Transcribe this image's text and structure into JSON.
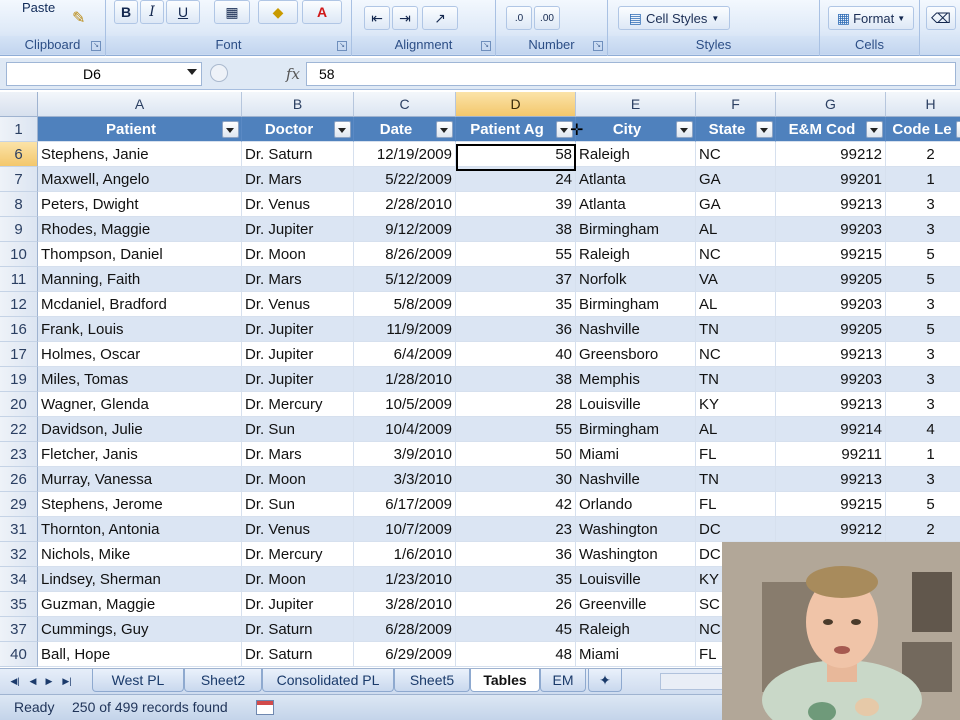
{
  "ribbon": {
    "groups": [
      {
        "label": "Clipboard"
      },
      {
        "label": "Font"
      },
      {
        "label": "Alignment"
      },
      {
        "label": "Number"
      },
      {
        "label": "Styles"
      },
      {
        "label": "Cells"
      }
    ],
    "paste_label": "Paste",
    "bold_label": "B",
    "italic_label": "I",
    "underline_label": "U",
    "font_color_glyph": "A",
    "cell_styles_label": "Cell Styles",
    "format_label": "Format"
  },
  "formula_bar": {
    "name_box": "D6",
    "fx_label": "fx",
    "value": "58"
  },
  "columns": [
    "A",
    "B",
    "C",
    "D",
    "E",
    "F",
    "G",
    "H"
  ],
  "selected_column": "D",
  "header_row": {
    "row_number": "1",
    "cells": [
      "Patient",
      "Doctor",
      "Date",
      "Patient Ag",
      "City",
      "State",
      "E&M Cod",
      "Code Le"
    ]
  },
  "rows": [
    {
      "n": "6",
      "patient": "Stephens, Janie",
      "doctor": "Dr. Saturn",
      "date": "12/19/2009",
      "age": "58",
      "city": "Raleigh",
      "state": "NC",
      "code": "99212",
      "level": "2"
    },
    {
      "n": "7",
      "patient": "Maxwell, Angelo",
      "doctor": "Dr. Mars",
      "date": "5/22/2009",
      "age": "24",
      "city": "Atlanta",
      "state": "GA",
      "code": "99201",
      "level": "1"
    },
    {
      "n": "8",
      "patient": "Peters, Dwight",
      "doctor": "Dr. Venus",
      "date": "2/28/2010",
      "age": "39",
      "city": "Atlanta",
      "state": "GA",
      "code": "99213",
      "level": "3"
    },
    {
      "n": "9",
      "patient": "Rhodes, Maggie",
      "doctor": "Dr. Jupiter",
      "date": "9/12/2009",
      "age": "38",
      "city": "Birmingham",
      "state": "AL",
      "code": "99203",
      "level": "3"
    },
    {
      "n": "10",
      "patient": "Thompson, Daniel",
      "doctor": "Dr. Moon",
      "date": "8/26/2009",
      "age": "55",
      "city": "Raleigh",
      "state": "NC",
      "code": "99215",
      "level": "5"
    },
    {
      "n": "11",
      "patient": "Manning, Faith",
      "doctor": "Dr. Mars",
      "date": "5/12/2009",
      "age": "37",
      "city": "Norfolk",
      "state": "VA",
      "code": "99205",
      "level": "5"
    },
    {
      "n": "12",
      "patient": "Mcdaniel, Bradford",
      "doctor": "Dr. Venus",
      "date": "5/8/2009",
      "age": "35",
      "city": "Birmingham",
      "state": "AL",
      "code": "99203",
      "level": "3"
    },
    {
      "n": "16",
      "patient": "Frank, Louis",
      "doctor": "Dr. Jupiter",
      "date": "11/9/2009",
      "age": "36",
      "city": "Nashville",
      "state": "TN",
      "code": "99205",
      "level": "5"
    },
    {
      "n": "17",
      "patient": "Holmes, Oscar",
      "doctor": "Dr. Jupiter",
      "date": "6/4/2009",
      "age": "40",
      "city": "Greensboro",
      "state": "NC",
      "code": "99213",
      "level": "3"
    },
    {
      "n": "19",
      "patient": "Miles, Tomas",
      "doctor": "Dr. Jupiter",
      "date": "1/28/2010",
      "age": "38",
      "city": "Memphis",
      "state": "TN",
      "code": "99203",
      "level": "3"
    },
    {
      "n": "20",
      "patient": "Wagner, Glenda",
      "doctor": "Dr. Mercury",
      "date": "10/5/2009",
      "age": "28",
      "city": "Louisville",
      "state": "KY",
      "code": "99213",
      "level": "3"
    },
    {
      "n": "22",
      "patient": "Davidson, Julie",
      "doctor": "Dr. Sun",
      "date": "10/4/2009",
      "age": "55",
      "city": "Birmingham",
      "state": "AL",
      "code": "99214",
      "level": "4"
    },
    {
      "n": "23",
      "patient": "Fletcher, Janis",
      "doctor": "Dr. Mars",
      "date": "3/9/2010",
      "age": "50",
      "city": "Miami",
      "state": "FL",
      "code": "99211",
      "level": "1"
    },
    {
      "n": "26",
      "patient": "Murray, Vanessa",
      "doctor": "Dr. Moon",
      "date": "3/3/2010",
      "age": "30",
      "city": "Nashville",
      "state": "TN",
      "code": "99213",
      "level": "3"
    },
    {
      "n": "29",
      "patient": "Stephens, Jerome",
      "doctor": "Dr. Sun",
      "date": "6/17/2009",
      "age": "42",
      "city": "Orlando",
      "state": "FL",
      "code": "99215",
      "level": "5"
    },
    {
      "n": "31",
      "patient": "Thornton, Antonia",
      "doctor": "Dr. Venus",
      "date": "10/7/2009",
      "age": "23",
      "city": "Washington",
      "state": "DC",
      "code": "99212",
      "level": "2"
    },
    {
      "n": "32",
      "patient": "Nichols, Mike",
      "doctor": "Dr. Mercury",
      "date": "1/6/2010",
      "age": "36",
      "city": "Washington",
      "state": "DC",
      "code": "",
      "level": ""
    },
    {
      "n": "34",
      "patient": "Lindsey, Sherman",
      "doctor": "Dr. Moon",
      "date": "1/23/2010",
      "age": "35",
      "city": "Louisville",
      "state": "KY",
      "code": "",
      "level": ""
    },
    {
      "n": "35",
      "patient": "Guzman, Maggie",
      "doctor": "Dr. Jupiter",
      "date": "3/28/2010",
      "age": "26",
      "city": "Greenville",
      "state": "SC",
      "code": "",
      "level": ""
    },
    {
      "n": "37",
      "patient": "Cummings, Guy",
      "doctor": "Dr. Saturn",
      "date": "6/28/2009",
      "age": "45",
      "city": "Raleigh",
      "state": "NC",
      "code": "",
      "level": ""
    },
    {
      "n": "40",
      "patient": "Ball, Hope",
      "doctor": "Dr. Saturn",
      "date": "6/29/2009",
      "age": "48",
      "city": "Miami",
      "state": "FL",
      "code": "",
      "level": ""
    }
  ],
  "sheet_tabs": [
    "West PL",
    "Sheet2",
    "Consolidated PL",
    "Sheet5",
    "Tables",
    "EM"
  ],
  "active_tab": "Tables",
  "status": {
    "ready": "Ready",
    "records": "250 of 499 records found"
  },
  "colors": {
    "table_header": "#4f81bd",
    "band": "#dbe5f3",
    "selected_header": "#f3c76c"
  }
}
